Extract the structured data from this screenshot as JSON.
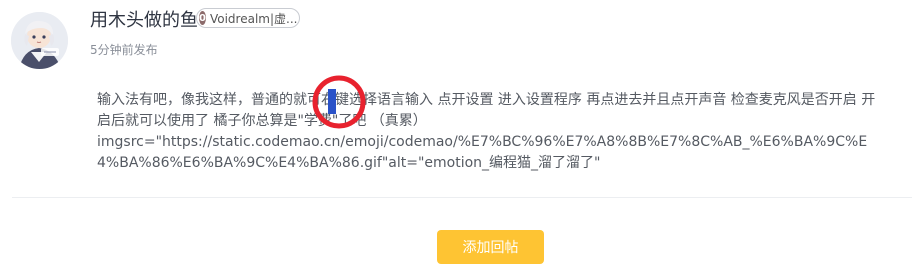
{
  "post": {
    "username": "用木头做的鱼",
    "badge": {
      "level": "0",
      "text": "Voidrealm|虚..."
    },
    "timestamp": "5分钟前发布",
    "content_line_1": "输入法有吧，像我这样，普通的就可右键选择语言输入 点开设置 进入设置程序 再点进去并且点开声音 检查麦克风是否开启 开启后就可以使用了 橘子你总算是\"学费\"了吧 （真累）",
    "content_line_2": "imgsrc=\"https://static.codemao.cn/emoji/codemao/%E7%BC%96%E7%A8%8B%E7%8C%AB_%E6%BA%9C%E4%BA%86%E6%BA%9C%E4%BA%86.gif\"alt=\"emotion_编程猫_溜了溜了\""
  },
  "actions": {
    "add_reply_label": "添加回帖"
  },
  "colors": {
    "accent_button": "#fec433",
    "annotation_red": "#e8222e",
    "cursor_blue": "#2a52c8"
  },
  "icons": {
    "avatar": "anime-character-avatar",
    "badge_level": "level-badge-icon",
    "annotation": "red-circle-annotation"
  }
}
